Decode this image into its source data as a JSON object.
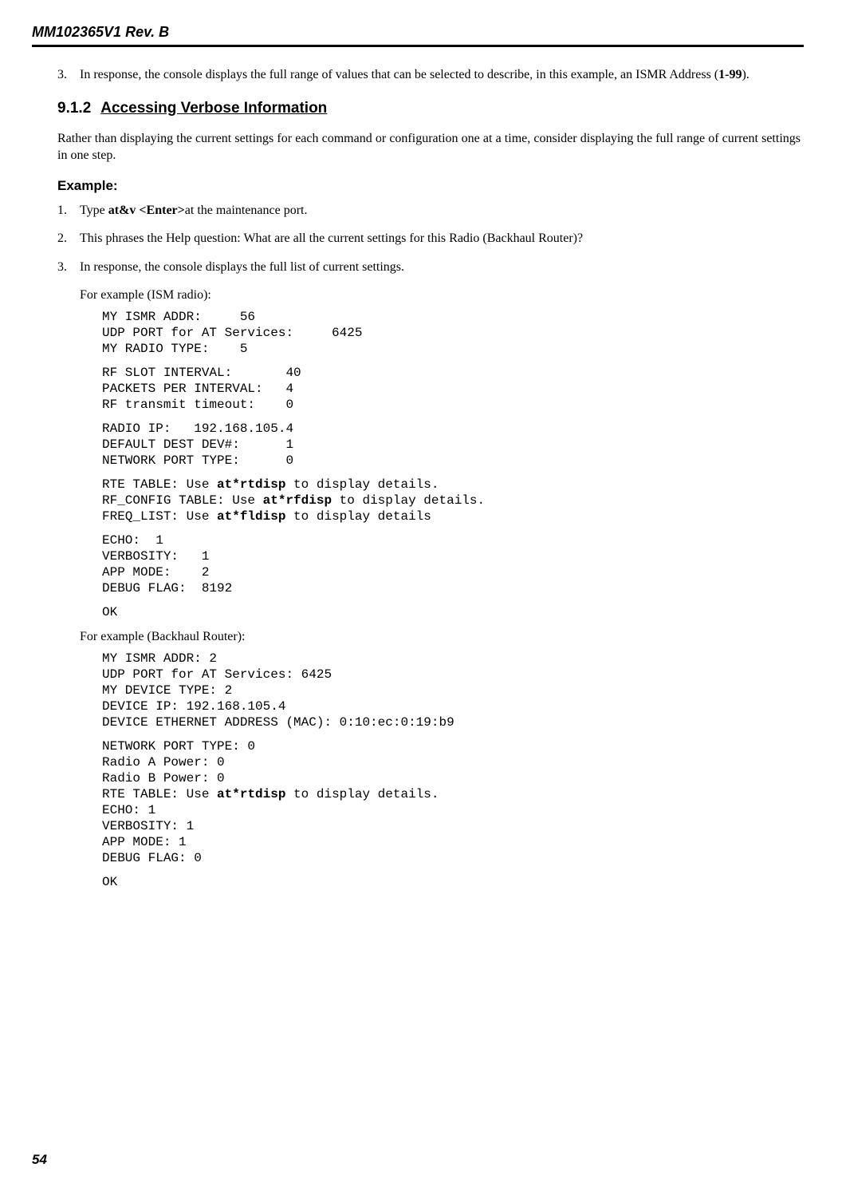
{
  "header": {
    "title": "MM102365V1 Rev. B"
  },
  "intro_item": {
    "num": "3.",
    "text_pre": "In response, the console displays the full range of values that can be selected to describe, in this example, an ISMR Address (",
    "bold": "1-99",
    "text_post": ")."
  },
  "section": {
    "num": "9.1.2",
    "title": "Accessing Verbose Information"
  },
  "section_para": "Rather than displaying the current settings for each command or configuration one at a time, consider displaying the full range of current settings in one step.",
  "example_label": "Example:",
  "steps": [
    {
      "num": "1.",
      "pre": "Type ",
      "bold": "at&v <Enter>",
      "post": "at the maintenance port."
    },
    {
      "num": "2.",
      "text": "This phrases the Help question: What are all the current settings for this Radio (Backhaul Router)?"
    },
    {
      "num": "3.",
      "text": "In response, the console displays the full list of current settings."
    }
  ],
  "for_example_1": "For example (ISM radio):",
  "code1_a": "MY ISMR ADDR:     56\nUDP PORT for AT Services:     6425\nMY RADIO TYPE:    5",
  "code1_b": "RF SLOT INTERVAL:       40\nPACKETS PER INTERVAL:   4\nRF transmit timeout:    0",
  "code1_c": "RADIO IP:   192.168.105.4\nDEFAULT DEST DEV#:      1\nNETWORK PORT TYPE:      0",
  "code1_d_l1a": "RTE TABLE: Use ",
  "code1_d_l1b": "at*rtdisp",
  "code1_d_l1c": " to display details.",
  "code1_d_l2a": "RF_CONFIG TABLE: Use ",
  "code1_d_l2b": "at*rfdisp",
  "code1_d_l2c": " to display details.",
  "code1_d_l3a": "FREQ_LIST: Use ",
  "code1_d_l3b": "at*fldisp",
  "code1_d_l3c": " to display details",
  "code1_e": "ECHO:  1\nVERBOSITY:   1\nAPP MODE:    2\nDEBUG FLAG:  8192",
  "code1_f": "OK",
  "for_example_2": "For example (Backhaul Router):",
  "code2_a": "MY ISMR ADDR: 2\nUDP PORT for AT Services: 6425\nMY DEVICE TYPE: 2\nDEVICE IP: 192.168.105.4\nDEVICE ETHERNET ADDRESS (MAC): 0:10:ec:0:19:b9",
  "code2_b_pre": "NETWORK PORT TYPE: 0\nRadio A Power: 0\nRadio B Power: 0\nRTE TABLE: Use ",
  "code2_b_bold": "at*rtdisp",
  "code2_b_post": " to display details.\nECHO: 1\nVERBOSITY: 1\nAPP MODE: 1\nDEBUG FLAG: 0",
  "code2_c": "OK",
  "page_number": "54"
}
